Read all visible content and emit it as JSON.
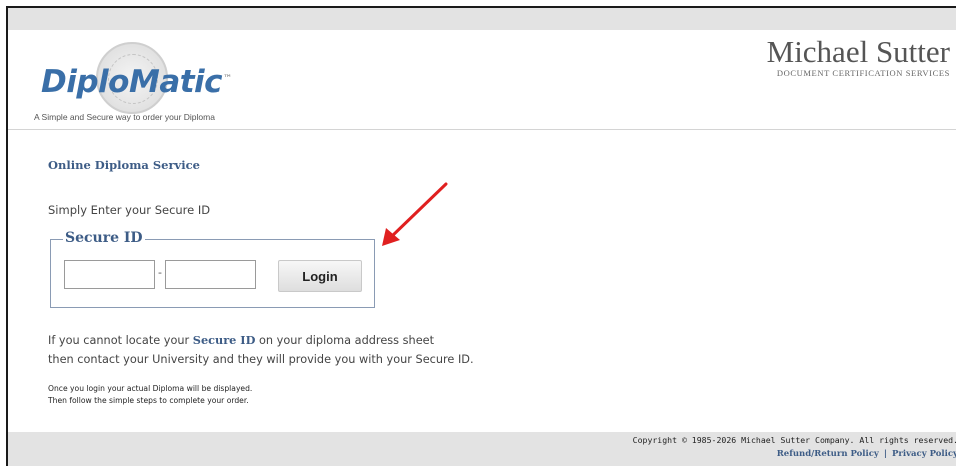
{
  "brand": {
    "logo_main": "DiploMatic",
    "logo_tm": "™",
    "tagline": "A Simple and Secure way to order your Diploma",
    "company_name": "Michael Sutter",
    "company_subtitle": "DOCUMENT CERTIFICATION SERVICES"
  },
  "main": {
    "service_title": "Online Diploma Service",
    "instruction": "Simply Enter your Secure ID",
    "legend": "Secure ID",
    "input1_value": "",
    "input2_value": "",
    "separator": "-",
    "login_label": "Login",
    "help_line1_prefix": "If you cannot locate your ",
    "help_line1_strong": "Secure ID",
    "help_line1_suffix": " on your diploma address sheet",
    "help_line2": "then contact your University and they will provide you with your Secure ID.",
    "note_line1": "Once you login your actual Diploma will be displayed.",
    "note_line2": "Then follow the simple steps to complete your order."
  },
  "footer": {
    "copyright": "Copyright © 1985-2026 Michael Sutter Company. All rights reserved.",
    "refund_link": "Refund/Return Policy",
    "link_separator": "|",
    "privacy_link": "Privacy Policy"
  },
  "colors": {
    "accent": "#3d5c86",
    "logo_blue": "#3a6fa8",
    "arrow_red": "#e02020",
    "band_gray": "#e3e3e3"
  }
}
